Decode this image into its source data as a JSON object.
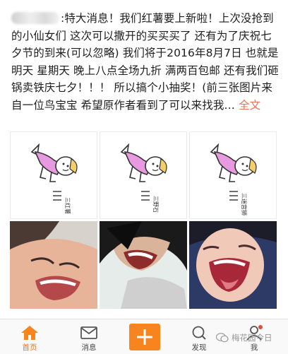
{
  "post": {
    "author_blurred": true,
    "body_text": ":特大消息！我们红薯要上新啦！上次没抢到的小仙女们 这次可以撒开的买买买了 还有为了庆祝七夕节的到来(可以忽略) 我们将于2016年8月7日 也就是明天 星期天 晚上八点全场九折 满两百包邮 还有我们砸锅卖铁庆七夕！！！ 所以搞个小抽奖！(前三张图片来自一位鸟宝宝 希望原作者看到了可以来找我…",
    "more_link": "全文"
  },
  "images": [
    {
      "kind": "cartoon",
      "caption": "三红薯"
    },
    {
      "kind": "cartoon",
      "caption": "三野石"
    },
    {
      "kind": "cartoon",
      "caption": "三迷宫狮"
    },
    {
      "kind": "photo",
      "description_icon": "laughing-face-photo"
    },
    {
      "kind": "photo",
      "description_icon": "laughing-face-photo"
    },
    {
      "kind": "photo",
      "description_icon": "laughing-face-photo"
    }
  ],
  "tabbar": {
    "home_label": "首页",
    "messages_label": "消息",
    "discover_label": "发现",
    "me_label": "我",
    "active_tab": "home",
    "accent_color": "#f7841d"
  },
  "watermark": {
    "text": "梅花园今日"
  }
}
